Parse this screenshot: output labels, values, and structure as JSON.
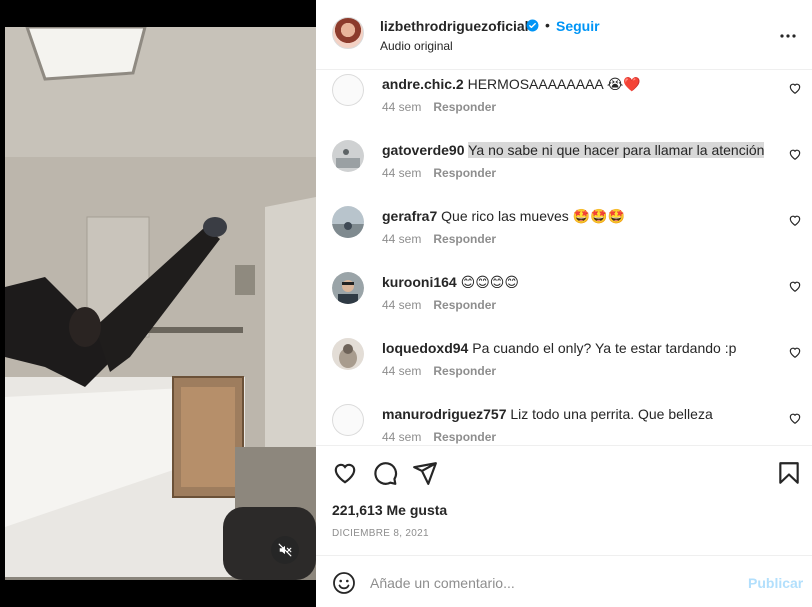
{
  "header": {
    "username": "lizbethrodriguezoficial",
    "separator": "•",
    "follow_label": "Seguir",
    "audio_label": "Audio original"
  },
  "comments": [
    {
      "user": "andre.chic.2",
      "text": "HERMOSAAAAAAAA 😭❤️",
      "age": "44 sem",
      "reply": "Responder",
      "highlight": false
    },
    {
      "user": "gatoverde90",
      "text": "Ya no sabe ni que hacer para llamar la atención",
      "age": "44 sem",
      "reply": "Responder",
      "highlight": true
    },
    {
      "user": "gerafra7",
      "text": "Que rico las mueves 🤩🤩🤩",
      "age": "44 sem",
      "reply": "Responder",
      "highlight": false
    },
    {
      "user": "kurooni164",
      "text": "😊😊😊😊",
      "age": "44 sem",
      "reply": "Responder",
      "highlight": false
    },
    {
      "user": "loquedoxd94",
      "text": "Pa cuando el only? Ya te estar tardando :p",
      "age": "44 sem",
      "reply": "Responder",
      "highlight": false
    },
    {
      "user": "manurodriguez757",
      "text": "Liz todo una perrita. Que belleza",
      "age": "44 sem",
      "reply": "Responder",
      "highlight": false
    }
  ],
  "stats": {
    "likes": "221,613 Me gusta",
    "date": "DICIEMBRE 8, 2021"
  },
  "composer": {
    "placeholder": "Añade un comentario...",
    "publish_label": "Publicar"
  },
  "icons": {
    "verified": "verified-badge-icon",
    "more": "more-options-icon",
    "like": "heart-icon",
    "comment": "comment-icon",
    "share": "share-icon",
    "save": "bookmark-icon",
    "emoji": "emoji-icon",
    "mute": "muted-speaker-icon"
  },
  "colors": {
    "link": "#0095f6",
    "publish_disabled": "#b2dffc",
    "secondary_text": "#8e8e8e"
  }
}
